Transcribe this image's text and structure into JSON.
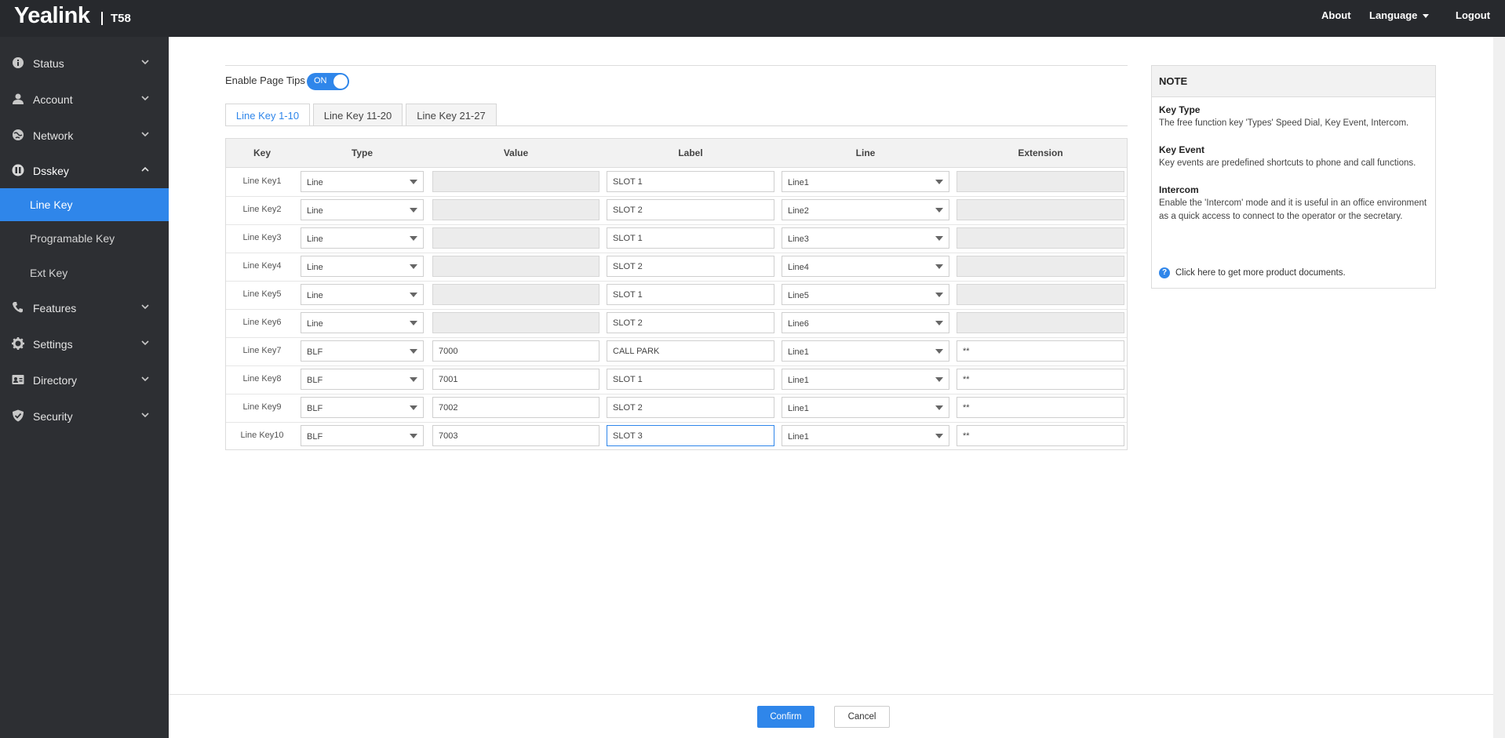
{
  "header": {
    "brand": "Yealink",
    "model": "T58",
    "about": "About",
    "language": "Language",
    "logout": "Logout"
  },
  "sidebar": {
    "status": "Status",
    "account": "Account",
    "network": "Network",
    "dsskey": "Dsskey",
    "line_key": "Line Key",
    "programable_key": "Programable Key",
    "ext_key": "Ext Key",
    "features": "Features",
    "settings": "Settings",
    "directory": "Directory",
    "security": "Security"
  },
  "page_tips": {
    "label": "Enable Page Tips",
    "toggle": "ON"
  },
  "tabs": [
    "Line Key 1-10",
    "Line Key 11-20",
    "Line Key 21-27"
  ],
  "table": {
    "headers": [
      "Key",
      "Type",
      "Value",
      "Label",
      "Line",
      "Extension"
    ],
    "rows": [
      {
        "key": "Line Key1",
        "type": "Line",
        "value": "",
        "label": "SLOT 1",
        "line": "Line1",
        "extension": ""
      },
      {
        "key": "Line Key2",
        "type": "Line",
        "value": "",
        "label": "SLOT 2",
        "line": "Line2",
        "extension": ""
      },
      {
        "key": "Line Key3",
        "type": "Line",
        "value": "",
        "label": "SLOT 1",
        "line": "Line3",
        "extension": ""
      },
      {
        "key": "Line Key4",
        "type": "Line",
        "value": "",
        "label": "SLOT 2",
        "line": "Line4",
        "extension": ""
      },
      {
        "key": "Line Key5",
        "type": "Line",
        "value": "",
        "label": "SLOT 1",
        "line": "Line5",
        "extension": ""
      },
      {
        "key": "Line Key6",
        "type": "Line",
        "value": "",
        "label": "SLOT 2",
        "line": "Line6",
        "extension": ""
      },
      {
        "key": "Line Key7",
        "type": "BLF",
        "value": "7000",
        "label": "CALL PARK",
        "line": "Line1",
        "extension": "**"
      },
      {
        "key": "Line Key8",
        "type": "BLF",
        "value": "7001",
        "label": "SLOT 1",
        "line": "Line1",
        "extension": "**"
      },
      {
        "key": "Line Key9",
        "type": "BLF",
        "value": "7002",
        "label": "SLOT 2",
        "line": "Line1",
        "extension": "**"
      },
      {
        "key": "Line Key10",
        "type": "BLF",
        "value": "7003",
        "label": "SLOT 3",
        "line": "Line1",
        "extension": "**"
      }
    ]
  },
  "note": {
    "title": "NOTE",
    "key_type_title": "Key Type",
    "key_type_text": "The free function key 'Types' Speed Dial, Key Event, Intercom.",
    "key_event_title": "Key Event",
    "key_event_text": "Key events are predefined shortcuts to phone and call functions.",
    "intercom_title": "Intercom",
    "intercom_text": "Enable the 'Intercom' mode and it is useful in an office environment as a quick access to connect to the operator or the secretary.",
    "help_link": "Click here to get more product documents."
  },
  "buttons": {
    "confirm": "Confirm",
    "cancel": "Cancel"
  },
  "colors": {
    "accent": "#2f86ea",
    "header_bg": "#27292d",
    "sidebar_bg": "#2d2f33"
  }
}
